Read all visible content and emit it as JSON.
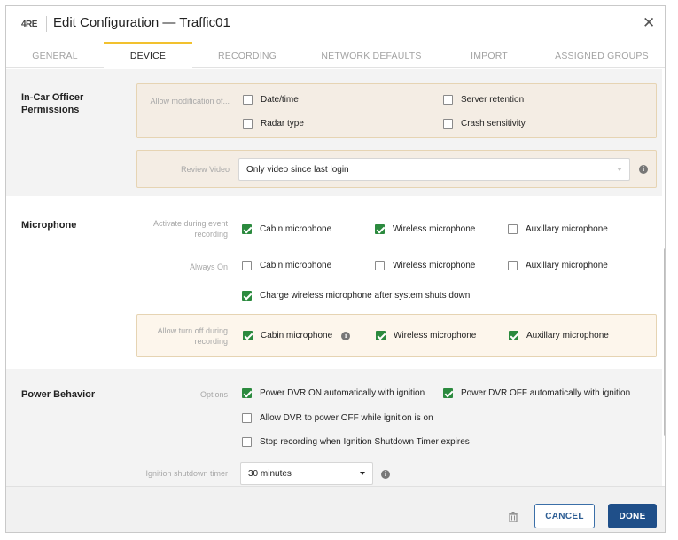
{
  "header": {
    "logo": "4RE",
    "title": "Edit Configuration — Traffic01",
    "close_icon": "close-icon"
  },
  "tabs": [
    {
      "label": "GENERAL",
      "active": false
    },
    {
      "label": "DEVICE",
      "active": true
    },
    {
      "label": "RECORDING",
      "active": false
    },
    {
      "label": "NETWORK DEFAULTS",
      "active": false
    },
    {
      "label": "IMPORT",
      "active": false
    },
    {
      "label": "ASSIGNED GROUPS",
      "active": false
    }
  ],
  "officer": {
    "title": "In-Car Officer Permissions",
    "allow_label": "Allow modification of...",
    "options": [
      {
        "label": "Date/time",
        "checked": false
      },
      {
        "label": "Server retention",
        "checked": false
      },
      {
        "label": "Radar type",
        "checked": false
      },
      {
        "label": "Crash sensitivity",
        "checked": false
      }
    ],
    "review_label": "Review Video",
    "review_value": "Only video since last login"
  },
  "microphone": {
    "title": "Microphone",
    "activate_label": "Activate during event recording",
    "activate": [
      {
        "label": "Cabin microphone",
        "checked": true
      },
      {
        "label": "Wireless microphone",
        "checked": true
      },
      {
        "label": "Auxillary microphone",
        "checked": false
      }
    ],
    "always_label": "Always On",
    "always": [
      {
        "label": "Cabin microphone",
        "checked": false
      },
      {
        "label": "Wireless microphone",
        "checked": false
      },
      {
        "label": "Auxillary microphone",
        "checked": false
      }
    ],
    "charge": {
      "label": "Charge wireless microphone after system shuts down",
      "checked": true
    },
    "turnoff_label": "Allow turn off during recording",
    "turnoff": [
      {
        "label": "Cabin microphone",
        "checked": true
      },
      {
        "label": "Wireless microphone",
        "checked": true
      },
      {
        "label": "Auxillary microphone",
        "checked": true
      }
    ]
  },
  "power": {
    "title": "Power Behavior",
    "options_label": "Options",
    "options": [
      {
        "label": "Power DVR ON automatically with ignition",
        "checked": true
      },
      {
        "label": "Power DVR OFF automatically with ignition",
        "checked": true
      },
      {
        "label": "Allow DVR to power OFF while ignition is on",
        "checked": false
      },
      {
        "label": "Stop recording when Ignition Shutdown Timer expires",
        "checked": false
      }
    ],
    "timer_label": "Ignition shutdown timer",
    "timer_value": "30 minutes"
  },
  "footer": {
    "cancel": "CANCEL",
    "done": "DONE"
  },
  "colors": {
    "accent_tab": "#f2c12e",
    "check_green": "#2b8a3e",
    "primary_button": "#1f4f89",
    "panel_tan": "#f4ede4"
  }
}
